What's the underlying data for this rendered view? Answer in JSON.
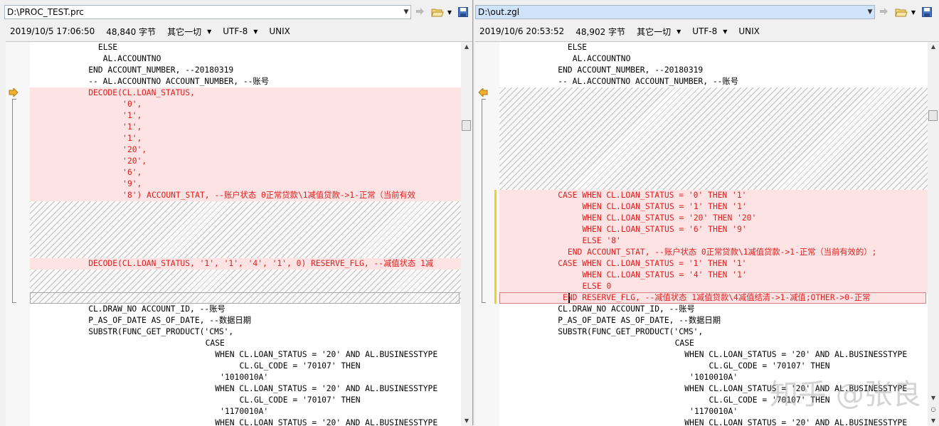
{
  "left": {
    "path": "D:\\PROC_TEST.prc",
    "date": "2019/10/5 17:06:50",
    "size": "48,840 字节",
    "format": "其它一切",
    "encoding": "UTF-8",
    "line_ending": "UNIX",
    "lines": [
      {
        "row": 0,
        "indent": 14,
        "text": "ELSE",
        "diff": false
      },
      {
        "row": 1,
        "indent": 15,
        "text": "AL.ACCOUNTNO",
        "diff": false
      },
      {
        "row": 2,
        "indent": 12,
        "text": "END ACCOUNT_NUMBER, --20180319",
        "diff": false
      },
      {
        "row": 3,
        "indent": 12,
        "text": "-- AL.ACCOUNTNO ACCOUNT_NUMBER, --账号",
        "diff": false
      },
      {
        "row": 4,
        "indent": 12,
        "text": "DECODE(CL.LOAN_STATUS,",
        "diff": true
      },
      {
        "row": 5,
        "indent": 19,
        "text": "'0',",
        "diff": true
      },
      {
        "row": 6,
        "indent": 19,
        "text": "'1',",
        "diff": true
      },
      {
        "row": 7,
        "indent": 19,
        "text": "'1',",
        "diff": true
      },
      {
        "row": 8,
        "indent": 19,
        "text": "'1',",
        "diff": true
      },
      {
        "row": 9,
        "indent": 19,
        "text": "'20',",
        "diff": true
      },
      {
        "row": 10,
        "indent": 19,
        "text": "'20',",
        "diff": true
      },
      {
        "row": 11,
        "indent": 19,
        "text": "'6',",
        "diff": true
      },
      {
        "row": 12,
        "indent": 19,
        "text": "'9',",
        "diff": true
      },
      {
        "row": 13,
        "indent": 19,
        "text": "'8') ACCOUNT_STAT, --账户状态 0正常贷款\\1减值贷款->1-正常（当前有效",
        "diff": true
      },
      {
        "row": 19,
        "indent": 12,
        "text": "DECODE(CL.LOAN_STATUS, '1', '1', '4', '1', 0) RESERVE_FLG, --减值状态 1减",
        "diff": true
      },
      {
        "row": 23,
        "indent": 12,
        "text": "CL.DRAW_NO ACCOUNT_ID, --账号",
        "diff": false
      },
      {
        "row": 24,
        "indent": 12,
        "text": "P_AS_OF_DATE AS_OF_DATE, --数据日期",
        "diff": false
      },
      {
        "row": 25,
        "indent": 12,
        "text": "SUBSTR(FUNC_GET_PRODUCT('CMS',",
        "diff": false
      },
      {
        "row": 26,
        "indent": 36,
        "text": "CASE",
        "diff": false
      },
      {
        "row": 27,
        "indent": 38,
        "text": "WHEN CL.LOAN_STATUS = '20' AND AL.BUSINESSTYPE",
        "diff": false
      },
      {
        "row": 28,
        "indent": 43,
        "text": "CL.GL_CODE = '70107' THEN",
        "diff": false
      },
      {
        "row": 29,
        "indent": 39,
        "text": "'1010010A'",
        "diff": false
      },
      {
        "row": 30,
        "indent": 38,
        "text": "WHEN CL.LOAN_STATUS = '20' AND AL.BUSINESSTYPE",
        "diff": false
      },
      {
        "row": 31,
        "indent": 43,
        "text": "CL.GL_CODE = '70107' THEN",
        "diff": false
      },
      {
        "row": 32,
        "indent": 39,
        "text": "'1170010A'",
        "diff": false
      },
      {
        "row": 33,
        "indent": 38,
        "text": "WHEN CL.LOAN_STATUS = '20' AND AL.BUSINESSTYPE",
        "diff": false
      }
    ]
  },
  "right": {
    "path": "D:\\out.zgl",
    "date": "2019/10/6 20:53:52",
    "size": "48,902 字节",
    "format": "其它一切",
    "encoding": "UTF-8",
    "line_ending": "UNIX",
    "lines": [
      {
        "row": 0,
        "indent": 14,
        "text": "ELSE",
        "diff": false
      },
      {
        "row": 1,
        "indent": 15,
        "text": "AL.ACCOUNTNO",
        "diff": false
      },
      {
        "row": 2,
        "indent": 12,
        "text": "END ACCOUNT_NUMBER, --20180319",
        "diff": false
      },
      {
        "row": 3,
        "indent": 12,
        "text": "-- AL.ACCOUNTNO ACCOUNT_NUMBER, --账号",
        "diff": false
      },
      {
        "row": 13,
        "indent": 12,
        "text": "CASE WHEN CL.LOAN_STATUS = '0' THEN '1'",
        "diff": true
      },
      {
        "row": 14,
        "indent": 17,
        "text": "WHEN CL.LOAN_STATUS = '1' THEN '1'",
        "diff": true
      },
      {
        "row": 15,
        "indent": 17,
        "text": "WHEN CL.LOAN_STATUS = '20' THEN '20'",
        "diff": true
      },
      {
        "row": 16,
        "indent": 17,
        "text": "WHEN CL.LOAN_STATUS = '6' THEN '9'",
        "diff": true
      },
      {
        "row": 17,
        "indent": 17,
        "text": "ELSE '8'",
        "diff": true
      },
      {
        "row": 18,
        "indent": 14,
        "text": "END ACCOUNT_STAT, --账户状态 0正常贷款\\1减值贷款->1-正常（当前有效的）;",
        "diff": true
      },
      {
        "row": 19,
        "indent": 12,
        "text": "CASE WHEN CL.LOAN_STATUS = '1' THEN '1'",
        "diff": true
      },
      {
        "row": 20,
        "indent": 17,
        "text": "WHEN CL.LOAN_STATUS = '4' THEN '1'",
        "diff": true
      },
      {
        "row": 21,
        "indent": 17,
        "text": "ELSE 0",
        "diff": true
      },
      {
        "row": 22,
        "indent": 13,
        "text": "END RESERVE_FLG, --减值状态 1减值贷款\\4减值结清->1-减值;OTHER->0-正常",
        "diff": true
      },
      {
        "row": 23,
        "indent": 12,
        "text": "CL.DRAW_NO ACCOUNT_ID, --账号",
        "diff": false
      },
      {
        "row": 24,
        "indent": 12,
        "text": "P_AS_OF_DATE AS_OF_DATE, --数据日期",
        "diff": false
      },
      {
        "row": 25,
        "indent": 12,
        "text": "SUBSTR(FUNC_GET_PRODUCT('CMS',",
        "diff": false
      },
      {
        "row": 26,
        "indent": 36,
        "text": "CASE",
        "diff": false
      },
      {
        "row": 27,
        "indent": 38,
        "text": "WHEN CL.LOAN_STATUS = '20' AND AL.BUSINESSTYPE",
        "diff": false
      },
      {
        "row": 28,
        "indent": 43,
        "text": "CL.GL_CODE = '70107' THEN",
        "diff": false
      },
      {
        "row": 29,
        "indent": 39,
        "text": "'1010010A'",
        "diff": false
      },
      {
        "row": 30,
        "indent": 38,
        "text": "WHEN CL.LOAN_STATUS = '20' AND AL.BUSINESSTYPE",
        "diff": false
      },
      {
        "row": 31,
        "indent": 43,
        "text": "CL.GL_CODE = '70107' THEN",
        "diff": false
      },
      {
        "row": 32,
        "indent": 39,
        "text": "'1170010A'",
        "diff": false
      },
      {
        "row": 33,
        "indent": 38,
        "text": "WHEN CL.LOAN_STATUS = '20' AND AL.BUSINESSTYPE",
        "diff": false
      }
    ]
  },
  "watermark": "知乎 @张良",
  "colors": {
    "diff_bg": "#fde3e3",
    "diff_text": "#e02020",
    "nav_arrow": "#f0b030",
    "change_bar": "#f0d020"
  }
}
